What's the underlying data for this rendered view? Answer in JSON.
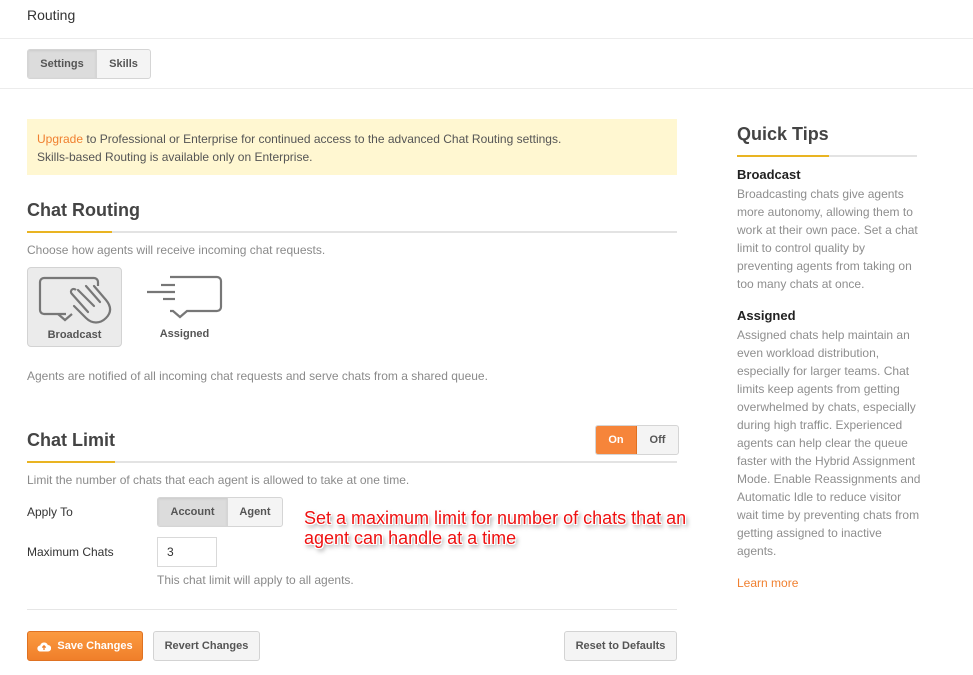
{
  "header": {
    "title": "Routing"
  },
  "tabs": [
    {
      "label": "Settings",
      "active": true
    },
    {
      "label": "Skills",
      "active": false
    }
  ],
  "notice": {
    "link": "Upgrade",
    "line1_rest": " to Professional or Enterprise for continued access to the advanced Chat Routing settings.",
    "line2": "Skills-based Routing is available only on Enterprise."
  },
  "chat_routing": {
    "title": "Chat Routing",
    "description": "Choose how agents will receive incoming chat requests.",
    "modes": [
      {
        "label": "Broadcast",
        "icon": "broadcast-hand-icon",
        "selected": true
      },
      {
        "label": "Assigned",
        "icon": "assigned-chat-icon",
        "selected": false
      }
    ],
    "mode_description": "Agents are notified of all incoming chat requests and serve chats from a shared queue."
  },
  "chat_limit": {
    "title": "Chat Limit",
    "toggle": {
      "on_label": "On",
      "off_label": "Off",
      "value": "On"
    },
    "description": "Limit the number of chats that each agent is allowed to take at one time.",
    "apply_to": {
      "label": "Apply To",
      "options": [
        "Account",
        "Agent"
      ],
      "selected": "Account"
    },
    "maximum_chats": {
      "label": "Maximum Chats",
      "value": "3",
      "help": "This chat limit will apply to all agents."
    }
  },
  "annotation": {
    "text": "Set a maximum limit for number of chats that an agent can handle at a time",
    "color": "#ee1111"
  },
  "actions": {
    "save": "Save Changes",
    "revert": "Revert Changes",
    "reset": "Reset to Defaults"
  },
  "quick_tips": {
    "title": "Quick Tips",
    "tips": [
      {
        "heading": "Broadcast",
        "body": "Broadcasting chats give agents more autonomy, allowing them to work at their own pace. Set a chat limit to control quality by preventing agents from taking on too many chats at once."
      },
      {
        "heading": "Assigned",
        "body": "Assigned chats help maintain an even workload distribution, especially for larger teams. Chat limits keep agents from getting overwhelmed by chats, especially during high traffic. Experienced agents can help clear the queue faster with the Hybrid Assignment Mode. Enable Reassignments and Automatic Idle to reduce visitor wait time by preventing chats from getting assigned to inactive agents."
      }
    ],
    "learn_more": "Learn more"
  },
  "colors": {
    "accent_orange": "#f6853a",
    "heading_underline": "#e9b422",
    "notice_bg": "#fff7d1",
    "link": "#f08030"
  }
}
